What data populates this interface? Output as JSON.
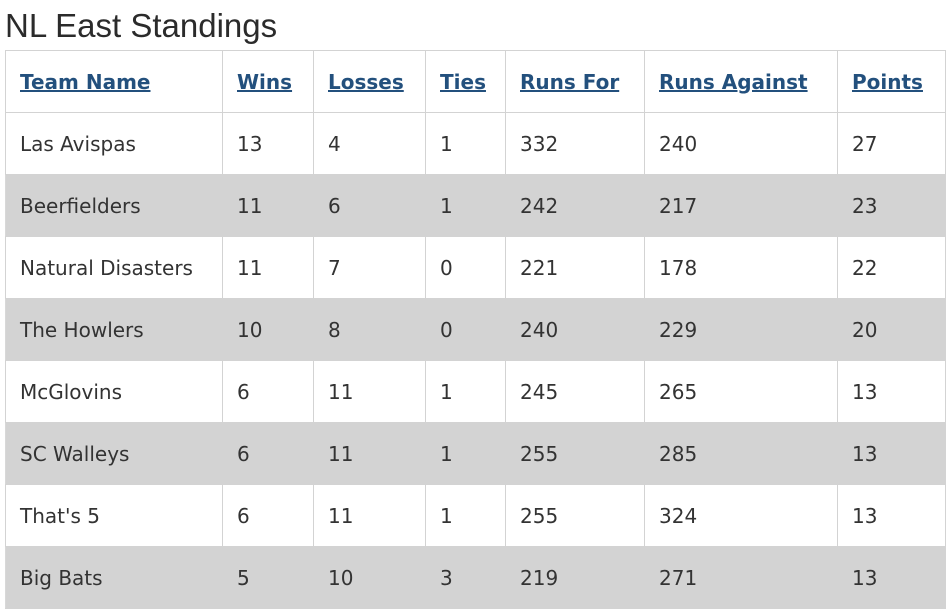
{
  "page": {
    "title": "NL East Standings"
  },
  "table": {
    "headers": [
      "Team Name",
      "Wins",
      "Losses",
      "Ties",
      "Runs For",
      "Runs Against",
      "Points"
    ],
    "rows": [
      [
        "Las Avispas",
        "13",
        "4",
        "1",
        "332",
        "240",
        "27"
      ],
      [
        "Beerfielders",
        "11",
        "6",
        "1",
        "242",
        "217",
        "23"
      ],
      [
        "Natural Disasters",
        "11",
        "7",
        "0",
        "221",
        "178",
        "22"
      ],
      [
        "The Howlers",
        "10",
        "8",
        "0",
        "240",
        "229",
        "20"
      ],
      [
        "McGlovins",
        "6",
        "11",
        "1",
        "245",
        "265",
        "13"
      ],
      [
        "SC Walleys",
        "6",
        "11",
        "1",
        "255",
        "285",
        "13"
      ],
      [
        "That's 5",
        "6",
        "11",
        "1",
        "255",
        "324",
        "13"
      ],
      [
        "Big Bats",
        "5",
        "10",
        "3",
        "219",
        "271",
        "13"
      ]
    ]
  },
  "colors": {
    "link": "#23507d",
    "stripe": "#d3d3d3",
    "border": "#d3d3d3"
  }
}
